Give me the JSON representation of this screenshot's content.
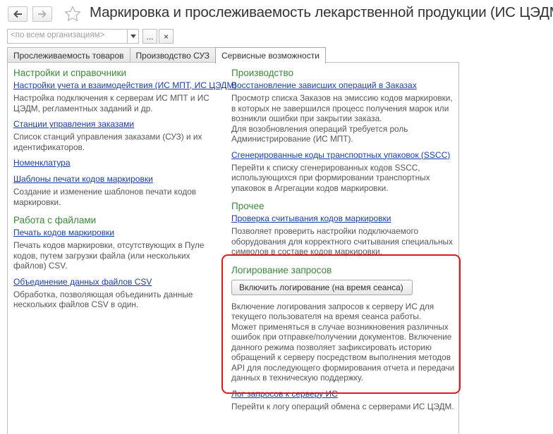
{
  "header": {
    "title": "Маркировка и прослеживаемость лекарственной продукции (ИС ЦЭДМ)"
  },
  "org_filter": {
    "placeholder": "<по всем организациям>",
    "select_button": "...",
    "clear_button": "×"
  },
  "tabs": [
    {
      "label": "Прослеживаемость товаров"
    },
    {
      "label": "Производство СУЗ"
    },
    {
      "label": "Сервисные возможности"
    }
  ],
  "left": {
    "settings": {
      "title": "Настройки и справочники",
      "items": [
        {
          "link": "Настройки учета и взаимодействия (ИС МПТ, ИС ЦЭДМ)",
          "desc": "Настройка подключения к серверам ИС МПТ и ИС ЦЭДМ, регламентных заданий и др."
        },
        {
          "link": "Станции управления заказами",
          "desc": "Список станций управления заказами (СУЗ) и их идентификаторов."
        },
        {
          "link": "Номенклатура",
          "desc": ""
        },
        {
          "link": "Шаблоны печати кодов маркировки",
          "desc": "Создание и изменение шаблонов печати кодов маркировки."
        }
      ]
    },
    "files": {
      "title": "Работа с файлами",
      "items": [
        {
          "link": "Печать кодов маркировки",
          "desc": "Печать кодов маркировки, отсутствующих в Пуле кодов, путем загрузки файла (или нескольких файлов) CSV."
        },
        {
          "link": "Объединение данных файлов CSV",
          "desc": "Обработка, позволяющая объединить данные нескольких файлов CSV в один."
        }
      ]
    }
  },
  "right": {
    "production": {
      "title": "Производство",
      "items": [
        {
          "link": "Восстановление зависших операций в Заказах",
          "desc": "Просмотр списка Заказов на эмиссию кодов маркировки, в которых не завершился процесс получения марок или возникли ошибки при закрытии заказа.\nДля возобновления операций требуется роль Администрирование (ИС МПТ)."
        },
        {
          "link": "Сгенерированные коды транспортных упаковок (SSCC)",
          "desc": "Перейти к списку сгенерированных кодов SSCC, использующихся при формировании транспортных упаковок в Агрегации кодов маркировки."
        }
      ]
    },
    "other": {
      "title": "Прочее",
      "items": [
        {
          "link": "Проверка считывания кодов маркировки",
          "desc": "Позволяет проверить настройки подключаемого оборудования для корректного считывания специальных символов в составе кодов маркировки."
        }
      ]
    },
    "logging": {
      "title": "Логирование запросов",
      "button": "Включить логирование (на время сеанса)",
      "button_desc": "Включение логирования запросов к серверу ИС для текущего пользователя на время сеанса работы.\nМожет применяться в случае возникновения различных ошибок при отправке/получении документов. Включение данного режима позволяет зафиксировать историю обращений к серверу посредством выполнения методов API для последующего формирования отчета и передачи данных в техническую поддержку.",
      "link": "Лог запросов к серверу ИС",
      "link_desc": "Перейти к логу операций обмена с серверами ИС ЦЭДМ."
    }
  },
  "colors": {
    "section_title": "#3a8a3a",
    "link": "#1a3cb0",
    "highlight": "#e0191e"
  }
}
